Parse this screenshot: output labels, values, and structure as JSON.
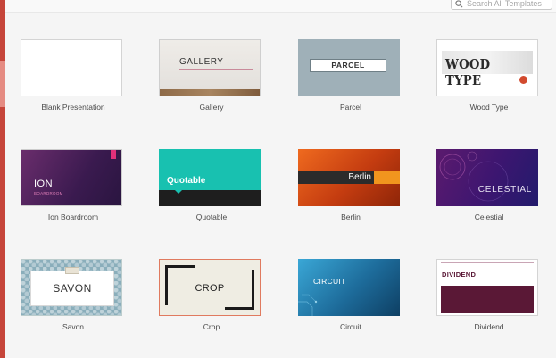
{
  "search": {
    "placeholder": "Search All Templates"
  },
  "templates": [
    {
      "label": "Blank Presentation"
    },
    {
      "label": "Gallery",
      "title": "GALLERY"
    },
    {
      "label": "Parcel",
      "title": "PARCEL"
    },
    {
      "label": "Wood Type",
      "title": "WOOD TYPE"
    },
    {
      "label": "Ion Boardroom",
      "title": "ION",
      "subtitle": "BOARDROOM"
    },
    {
      "label": "Quotable",
      "title": "Quotable"
    },
    {
      "label": "Berlin",
      "title": "Berlin"
    },
    {
      "label": "Celestial",
      "title": "CELESTIAL"
    },
    {
      "label": "Savon",
      "title": "SAVON"
    },
    {
      "label": "Crop",
      "title": "CROP"
    },
    {
      "label": "Circuit",
      "title": "CIRCUIT"
    },
    {
      "label": "Dividend",
      "title": "DIVIDEND"
    }
  ],
  "colors": {
    "sidebar_accent": "#c6453a",
    "selected_border": "#e07a5f"
  }
}
